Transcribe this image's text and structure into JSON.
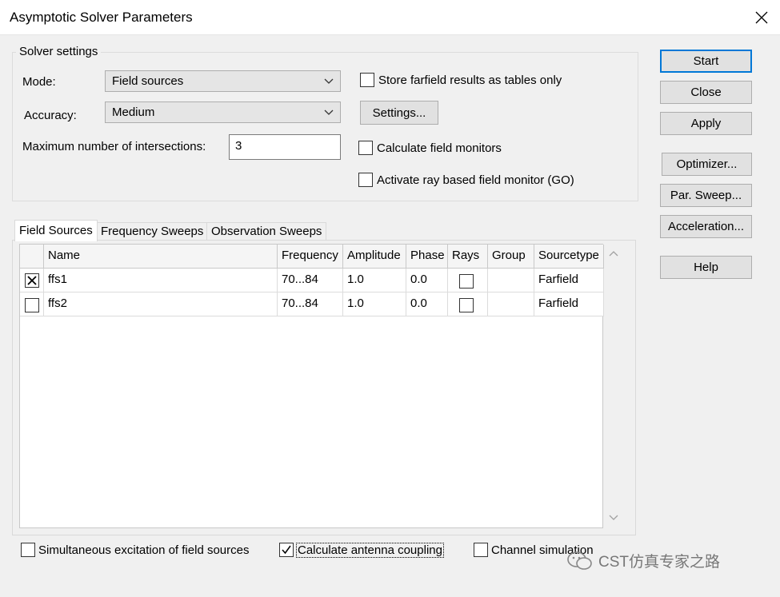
{
  "window": {
    "title": "Asymptotic Solver Parameters"
  },
  "solver_settings": {
    "legend": "Solver settings",
    "mode_label": "Mode:",
    "mode_value": "Field sources",
    "accuracy_label": "Accuracy:",
    "accuracy_value": "Medium",
    "max_intersections_label": "Maximum number of intersections:",
    "max_intersections_value": "3",
    "store_farfield_label": "Store farfield results as tables only",
    "store_farfield_checked": false,
    "settings_button": "Settings...",
    "calc_field_monitors_label": "Calculate field monitors",
    "calc_field_monitors_checked": false,
    "ray_monitor_label": "Activate ray based field monitor (GO)",
    "ray_monitor_checked": false
  },
  "side_buttons": {
    "start": "Start",
    "close": "Close",
    "apply": "Apply",
    "optimizer": "Optimizer...",
    "par_sweep": "Par. Sweep...",
    "acceleration": "Acceleration...",
    "help": "Help"
  },
  "tabs": [
    {
      "label": "Field Sources",
      "active": true
    },
    {
      "label": "Frequency Sweeps",
      "active": false
    },
    {
      "label": "Observation Sweeps",
      "active": false
    }
  ],
  "table": {
    "columns": [
      "Name",
      "Frequency",
      "Amplitude",
      "Phase",
      "Rays",
      "Group",
      "Sourcetype"
    ],
    "rows": [
      {
        "enabled": true,
        "name": "ffs1",
        "frequency": "70...84",
        "amplitude": "1.0",
        "phase": "0.0",
        "rays": false,
        "group": "",
        "sourcetype": "Farfield"
      },
      {
        "enabled": false,
        "name": "ffs2",
        "frequency": "70...84",
        "amplitude": "1.0",
        "phase": "0.0",
        "rays": false,
        "group": "",
        "sourcetype": "Farfield"
      }
    ]
  },
  "bottom_options": {
    "simultaneous_label": "Simultaneous excitation of field sources",
    "simultaneous_checked": false,
    "antenna_coupling_label": "Calculate antenna coupling",
    "antenna_coupling_checked": true,
    "channel_sim_label": "Channel simulation",
    "channel_sim_checked": false
  },
  "watermark": {
    "text": "CST仿真专家之路"
  },
  "colors": {
    "focus_blue": "#0078d7",
    "window_bg": "#f0f0f0"
  }
}
